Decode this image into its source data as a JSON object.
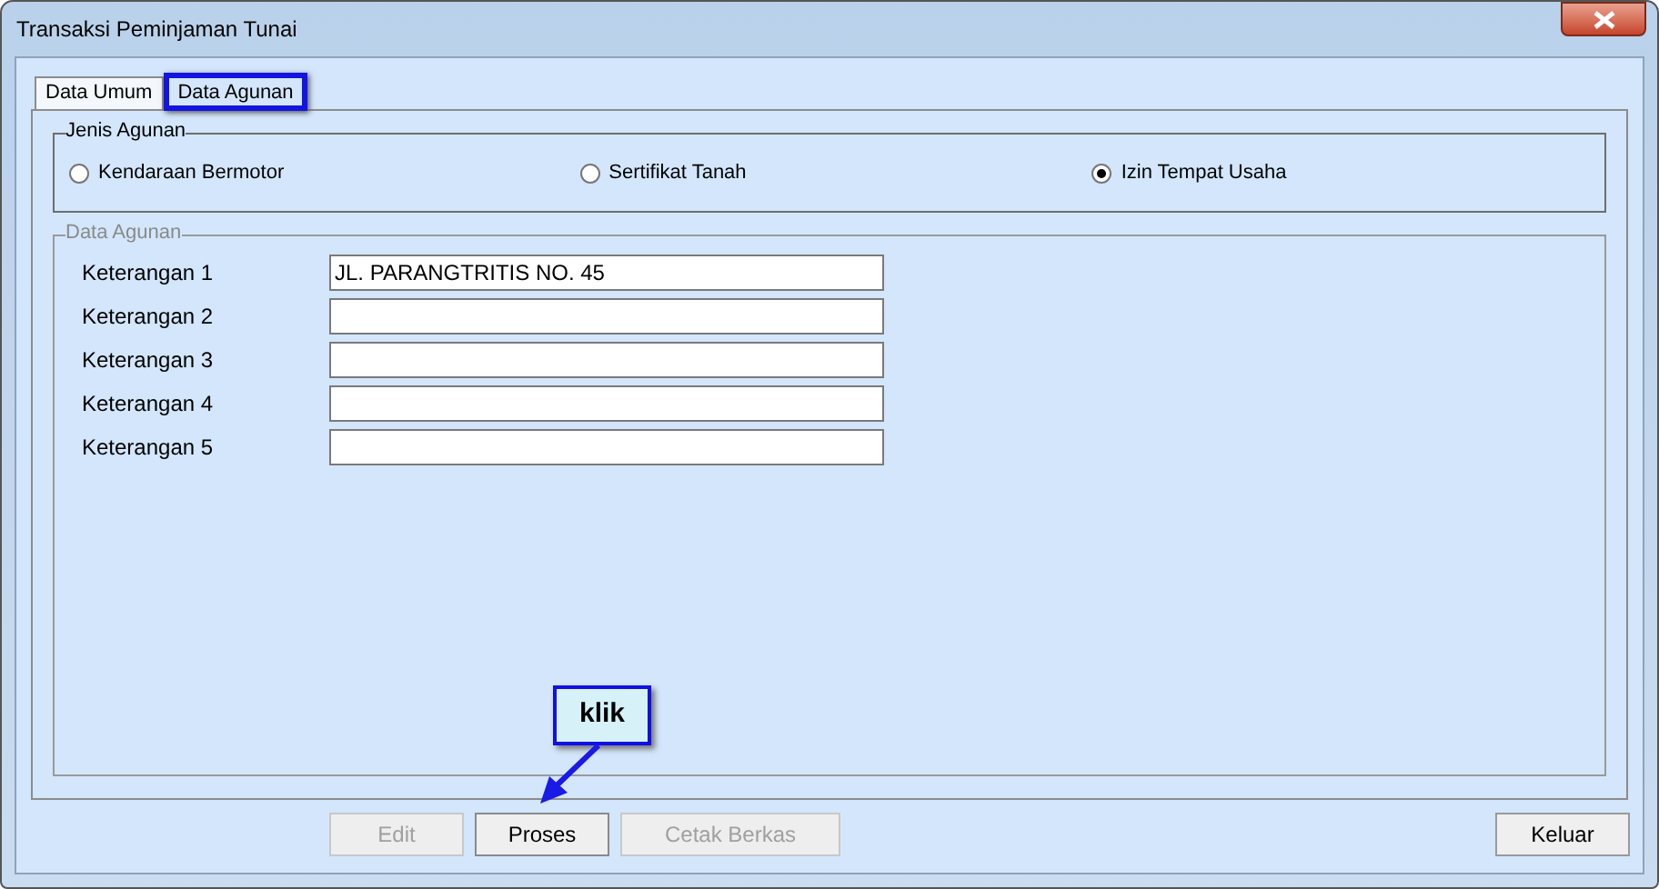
{
  "window": {
    "title": "Transaksi Peminjaman Tunai"
  },
  "tabs": [
    {
      "label": "Data Umum",
      "selected": false
    },
    {
      "label": "Data Agunan",
      "selected": true
    }
  ],
  "jenis_agunan": {
    "title": "Jenis Agunan",
    "options": [
      {
        "label": "Kendaraan Bermotor",
        "selected": false
      },
      {
        "label": "Sertifikat Tanah",
        "selected": false
      },
      {
        "label": "Izin Tempat Usaha",
        "selected": true
      }
    ]
  },
  "data_agunan": {
    "title": "Data Agunan",
    "fields": [
      {
        "label": "Keterangan 1",
        "value": "JL. PARANGTRITIS NO. 45"
      },
      {
        "label": "Keterangan 2"
      },
      {
        "label": "Keterangan 3"
      },
      {
        "label": "Keterangan 4"
      },
      {
        "label": "Keterangan 5"
      }
    ]
  },
  "buttons": [
    {
      "label": "Edit",
      "disabled": true
    },
    {
      "label": "Proses",
      "disabled": false
    },
    {
      "label": "Cetak Berkas",
      "disabled": true
    }
  ],
  "exit_button": {
    "label": "Keluar"
  },
  "callout": {
    "text": "klik"
  }
}
